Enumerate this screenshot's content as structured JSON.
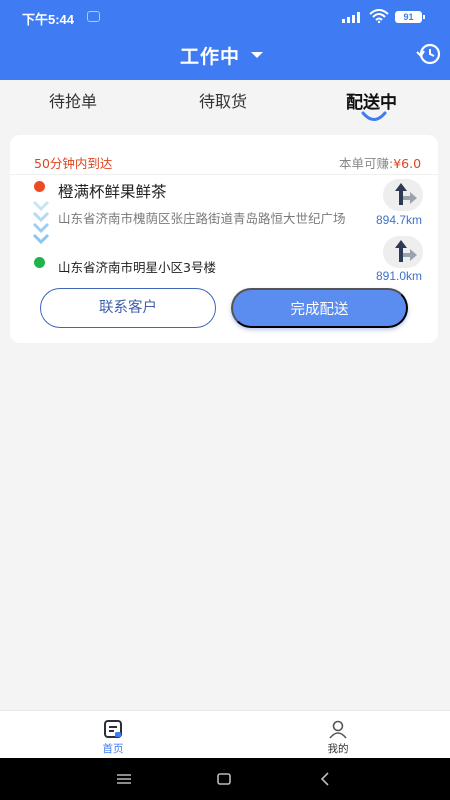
{
  "status_bar": {
    "time": "下午5:44",
    "battery": "91"
  },
  "header": {
    "title": "工作中"
  },
  "tabs": [
    {
      "label": "待抢单"
    },
    {
      "label": "待取货"
    },
    {
      "label": "配送中"
    }
  ],
  "order": {
    "deadline": "50分钟内到达",
    "earn_label": "本单可赚:",
    "earn_value": "¥6.0",
    "shop_name": "橙满杯鲜果鲜茶",
    "shop_address": "山东省济南市槐荫区张庄路街道青岛路恒大世纪广场",
    "shop_distance": "894.7km",
    "customer_address": "山东省济南市明星小区3号楼",
    "customer_distance": "891.0km",
    "contact_button": "联系客户",
    "complete_button": "完成配送"
  },
  "tabbar": [
    {
      "label": "首页"
    },
    {
      "label": "我的"
    }
  ],
  "colors": {
    "primary": "#3f7cf3",
    "deadline": "#e0431f",
    "pickup_dot": "#ec4a24",
    "dropoff_dot": "#22b24c"
  }
}
